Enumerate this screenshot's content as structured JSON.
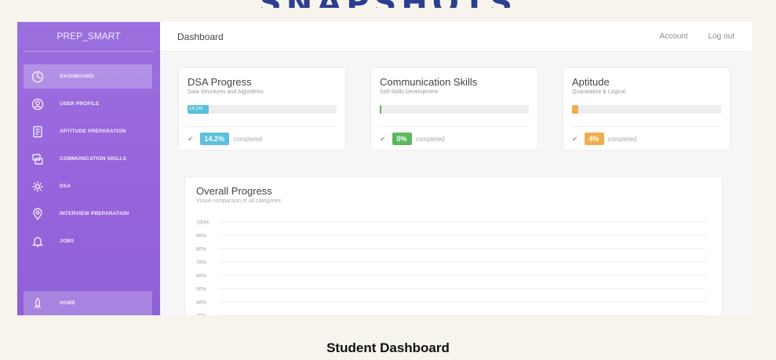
{
  "brand": "PREP_SMART",
  "colors": {
    "sidebar": "#9866dc",
    "blue": "#5bc0de",
    "green": "#5cb85c",
    "orange": "#f0ad4e"
  },
  "sidebar": {
    "items": [
      {
        "label": "Dashboard",
        "icon": "dashboard-icon",
        "active": true
      },
      {
        "label": "User Profile",
        "icon": "user-icon"
      },
      {
        "label": "Aptitude Preparation",
        "icon": "document-icon"
      },
      {
        "label": "Communication Skills",
        "icon": "chat-icon"
      },
      {
        "label": "DSA",
        "icon": "gear-icon"
      },
      {
        "label": "Interview Preparation",
        "icon": "location-icon"
      },
      {
        "label": "Jobs",
        "icon": "bell-icon"
      }
    ],
    "home": {
      "label": "Home",
      "icon": "rocket-icon"
    }
  },
  "header": {
    "title": "Dashboard",
    "account": "Account",
    "logout": "Log out"
  },
  "cards": [
    {
      "title": "DSA Progress",
      "subtitle": "Data Structures and Algorithms",
      "progress": 14.2,
      "bar_label": "14.2%",
      "badge": "14.2%",
      "status": "completed",
      "color": "#5bc0de"
    },
    {
      "title": "Communication Skills",
      "subtitle": "Soft Skills Development",
      "progress": 0,
      "bar_label": "",
      "badge": "0%",
      "status": "completed",
      "color": "#5cb85c"
    },
    {
      "title": "Aptitude",
      "subtitle": "Quantitative & Logical",
      "progress": 4,
      "bar_label": "",
      "badge": "4%",
      "status": "completed",
      "color": "#f0ad4e"
    }
  ],
  "chart": {
    "title": "Overall Progress",
    "subtitle": "Visual comparison of all categories"
  },
  "chart_data": {
    "type": "bar",
    "title": "Overall Progress",
    "subtitle": "Visual comparison of all categories",
    "y_ticks": [
      "100%",
      "90%",
      "80%",
      "70%",
      "60%",
      "50%",
      "40%",
      "30%"
    ],
    "ylim": [
      0,
      100
    ],
    "grid": true
  },
  "caption": "Student Dashboard",
  "banner": "SNAPSHOTS"
}
